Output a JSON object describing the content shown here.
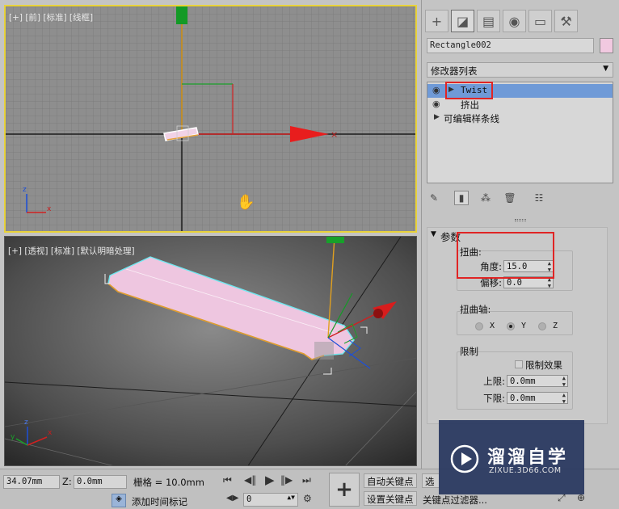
{
  "viewports": {
    "front_label": "[+] [前] [标准] [线框]",
    "persp_label": "[+] [透视] [标准] [默认明暗处理]",
    "front_axis": {
      "z": "z",
      "x": "x"
    },
    "persp_axis": {
      "z": "z",
      "x": "x",
      "y": "y"
    }
  },
  "command_panel": {
    "tabs": [
      "create-tab",
      "modify-tab",
      "hierarchy-tab",
      "motion-tab",
      "display-tab",
      "utilities-tab"
    ],
    "active_tab": "modify-tab",
    "object_name": "Rectangle002",
    "object_color": "#f1c9e0",
    "modifier_list_label": "修改器列表",
    "stack": [
      {
        "label": "Twist",
        "selected": true,
        "has_eye": true
      },
      {
        "label": "挤出",
        "selected": false,
        "has_eye": true
      },
      {
        "label": "可编辑样条线",
        "selected": false,
        "has_eye": false
      }
    ]
  },
  "parameters": {
    "rollout_title": "参数",
    "twist_group": "扭曲:",
    "angle_label": "角度:",
    "angle_value": "15.0",
    "bias_label": "偏移:",
    "bias_value": "0.0",
    "axis_group": "扭曲轴:",
    "axis_options": [
      "X",
      "Y",
      "Z"
    ],
    "axis_selected": "Y",
    "limits_group": "限制",
    "limit_effect_label": "限制效果",
    "upper_label": "上限:",
    "upper_value": "0.0mm",
    "lower_label": "下限:",
    "lower_value": "0.0mm"
  },
  "status_bar": {
    "x_value": "34.07mm",
    "z_label": "Z:",
    "z_value": "0.0mm",
    "grid_label": "栅格 = 10.0mm",
    "add_time_tag": "添加时间标记",
    "frame_value": "0",
    "auto_key": "自动关键点",
    "set_key": "设置关键点",
    "selected_fragment": "选",
    "key_filters": "关键点过滤器..."
  },
  "watermark": {
    "brand": "溜溜自学",
    "url": "ZIXUE.3D66.COM"
  }
}
